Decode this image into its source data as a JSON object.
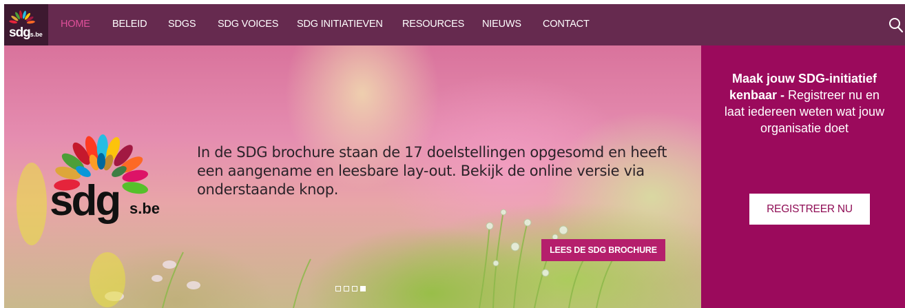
{
  "brand": {
    "logo_text": "sdg",
    "logo_suffix": "s.be",
    "hero_logo_text": "sdg",
    "hero_logo_suffix": "s.be"
  },
  "nav": {
    "items": [
      {
        "label": "HOME",
        "active": true
      },
      {
        "label": "BELEID"
      },
      {
        "label": "SDGS"
      },
      {
        "label": "SDG VOICES"
      },
      {
        "label": "SDG INITIATIEVEN"
      },
      {
        "label": "RESOURCES"
      },
      {
        "label": "NIEUWS"
      },
      {
        "label": "CONTACT"
      }
    ],
    "search_icon": "search-icon"
  },
  "hero": {
    "text": "In de SDG brochure staan de 17 doelstellingen opgesomd en heeft een aangename en leesbare lay-out. Bekijk de online versie via onderstaande knop.",
    "button_label": "LEES DE SDG BROCHURE",
    "slider": {
      "slide_count": 4,
      "active_index": 3
    }
  },
  "side_panel": {
    "bold_text": "Maak jouw SDG-initiatief kenbaar -",
    "text": " Registreer nu en laat iedereen weten wat jouw organisatie doet",
    "button_label": "REGISTREER NU"
  },
  "colors": {
    "nav_bg": "#662a4f",
    "logo_bg": "#3d1930",
    "active_nav": "#e0509a",
    "side_bg": "#9b0a5c",
    "button_pink": "#b51f6c"
  }
}
